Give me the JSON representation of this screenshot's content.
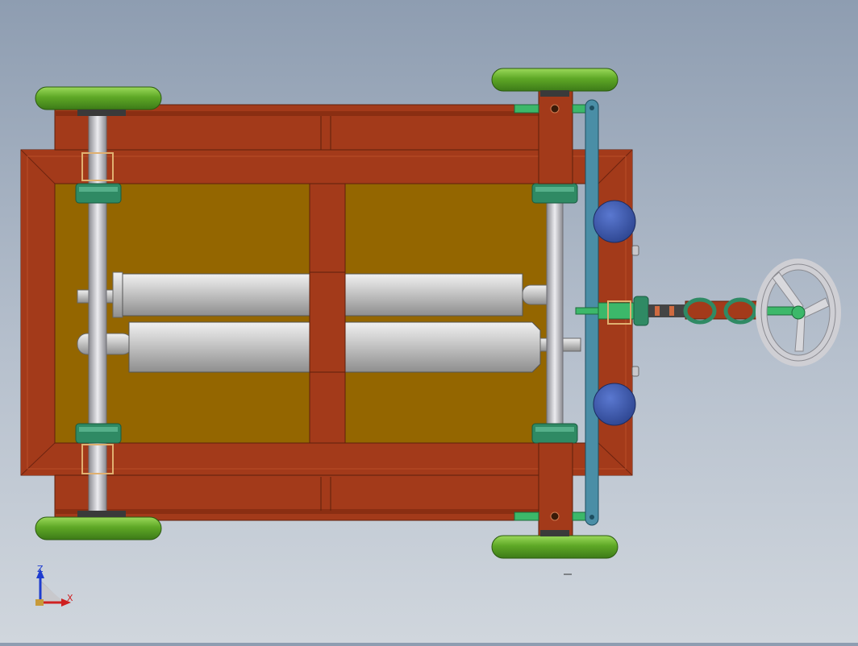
{
  "viewport": {
    "background_top": "#8e9db1",
    "background_bottom": "#d0d6dd"
  },
  "colors": {
    "frame": "#a33a1a",
    "frame_dark": "#6e2410",
    "floor": "#946600",
    "wheel": "#5ea826",
    "wheel_light": "#8fd04a",
    "axle": "#c8c8cc",
    "bearing": "#2f8a64",
    "cylinder": "#c4c4c4",
    "bar": "#4a8ea6",
    "disc": "#3552a8",
    "handwheel": "#d8d8dc",
    "shaft": "#3cb86a"
  },
  "icons": {
    "triad": "coordinate-triad-icon"
  },
  "triad": {
    "x_label": "X",
    "z_label": "Z"
  }
}
